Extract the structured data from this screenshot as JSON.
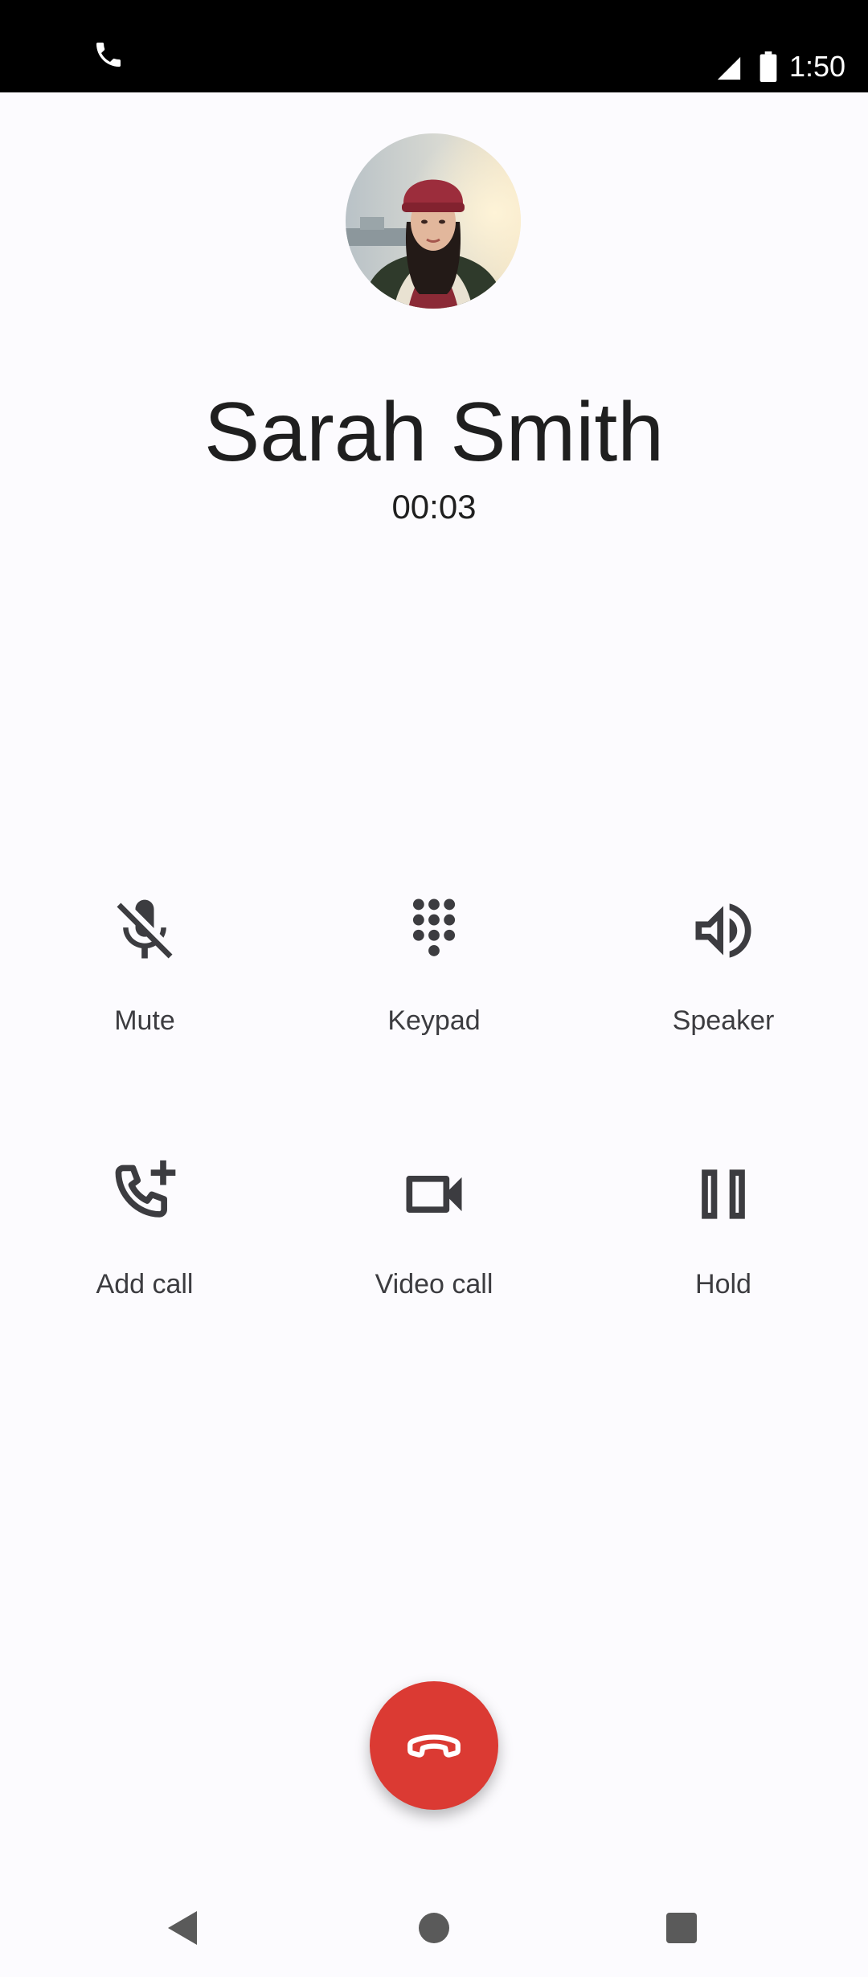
{
  "status_bar": {
    "time": "1:50",
    "call_icon": "phone-icon",
    "signal_icon": "cell-signal-icon",
    "battery_icon": "battery-icon"
  },
  "caller": {
    "name": "Sarah Smith",
    "timer": "00:03",
    "avatar": "contact-photo"
  },
  "controls": [
    {
      "label": "Mute",
      "icon": "mic-off-icon"
    },
    {
      "label": "Keypad",
      "icon": "dialpad-icon"
    },
    {
      "label": "Speaker",
      "icon": "speaker-icon"
    },
    {
      "label": "Add call",
      "icon": "add-call-icon"
    },
    {
      "label": "Video call",
      "icon": "video-camera-icon"
    },
    {
      "label": "Hold",
      "icon": "pause-icon"
    }
  ],
  "end_call": {
    "icon": "call-end-icon",
    "color": "#db3a33"
  },
  "nav_bar": {
    "back_icon": "back-triangle-icon",
    "home_icon": "home-circle-icon",
    "recents_icon": "recents-square-icon"
  },
  "colors": {
    "background": "#fcfbfe",
    "text_primary": "#1f1f1f",
    "icon": "#3c3c40"
  }
}
